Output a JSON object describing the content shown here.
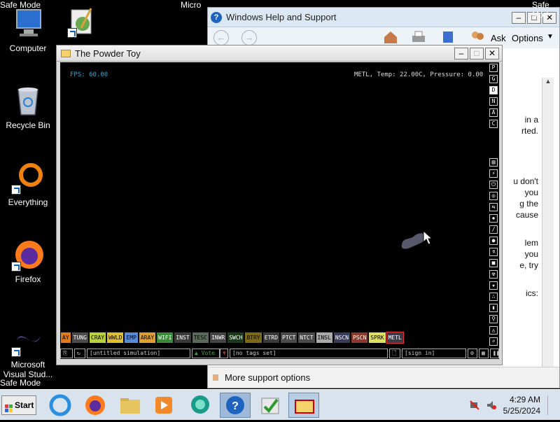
{
  "desktop": {
    "safe_mode_top": "Safe Mode",
    "safe_mode_bottom": "Safe Mode",
    "icons": {
      "computer": "Computer",
      "recycle": "Recycle Bin",
      "everything": "Everything",
      "firefox": "Firefox",
      "vstudio": "Microsoft Visual Stud..."
    },
    "partial_title": "Micro",
    "safe_mode_right": "Safe Mod"
  },
  "help_window": {
    "title": "Windows Help and Support",
    "toolbar": {
      "ask": "Ask",
      "options": "Options"
    },
    "body_fragments": [
      "in a",
      "rted.",
      "u don't",
      "you",
      "g the",
      "cause",
      "lem",
      "you",
      "e, try",
      "ics:"
    ],
    "footer": "More support options"
  },
  "powder_toy": {
    "title": "The Powder Toy",
    "fps": "FPS: 60.00",
    "hud": "METL, Temp: 22.00C, Pressure: 0.00",
    "right_top_buttons": [
      "P",
      "G",
      "D",
      "N",
      "A",
      "C"
    ],
    "selected_right_button": "D",
    "elements": [
      {
        "name": "AY",
        "color": "#e07a1a",
        "text": "#000"
      },
      {
        "name": "TUNG",
        "color": "#4a4a4a",
        "text": "#fff"
      },
      {
        "name": "CRAY",
        "color": "#b9d23a",
        "text": "#000"
      },
      {
        "name": "WWLD",
        "color": "#e0c030",
        "text": "#000"
      },
      {
        "name": "EMP",
        "color": "#5a8bd6",
        "text": "#000"
      },
      {
        "name": "ARAY",
        "color": "#e0a030",
        "text": "#000"
      },
      {
        "name": "WIFI",
        "color": "#3a8a3a",
        "text": "#fff"
      },
      {
        "name": "INST",
        "color": "#3a3a3a",
        "text": "#fff"
      },
      {
        "name": "TESC",
        "color": "#5a6a5a",
        "text": "#000"
      },
      {
        "name": "INWR",
        "color": "#444",
        "text": "#fff"
      },
      {
        "name": "SWCH",
        "color": "#1a3a1a",
        "text": "#fff"
      },
      {
        "name": "BTRY",
        "color": "#7a6a1a",
        "text": "#000"
      },
      {
        "name": "ETRD",
        "color": "#3a3a3a",
        "text": "#fff"
      },
      {
        "name": "PTCT",
        "color": "#4a4a4a",
        "text": "#fff"
      },
      {
        "name": "NTCT",
        "color": "#4a4a4a",
        "text": "#fff"
      },
      {
        "name": "INSL",
        "color": "#aaaaaa",
        "text": "#000"
      },
      {
        "name": "NSCN",
        "color": "#3a3a5a",
        "text": "#fff"
      },
      {
        "name": "PSCN",
        "color": "#8a3a2a",
        "text": "#fff"
      },
      {
        "name": "SPRK",
        "color": "#e0e060",
        "text": "#000"
      },
      {
        "name": "METL",
        "color": "#3a3a4a",
        "text": "#fff"
      }
    ],
    "selected_element": "METL",
    "bottom": {
      "sim_name": "[untitled simulation]",
      "vote": "Vote",
      "tags": "[no tags set]",
      "sign_in": "[sign in]"
    }
  },
  "taskbar": {
    "start": "Start",
    "time": "4:29 AM",
    "date": "5/25/2024"
  }
}
